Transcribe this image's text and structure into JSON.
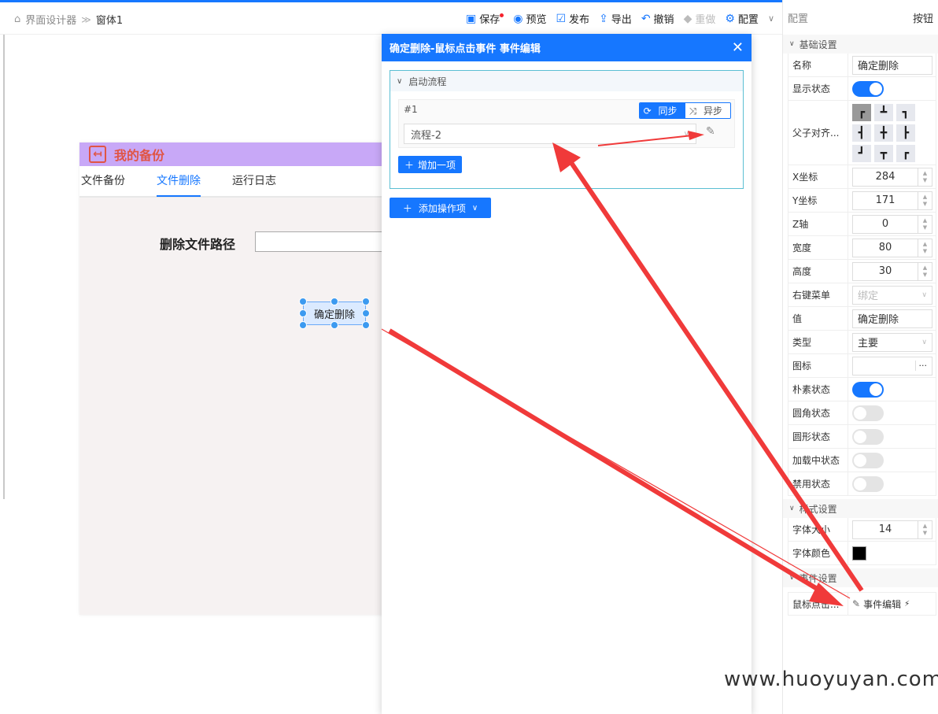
{
  "breadcrumb": {
    "root": "界面设计器",
    "current": "窗体1",
    "sep": "≫"
  },
  "toolbar": [
    {
      "label": "保存",
      "icon": "save-icon"
    },
    {
      "label": "预览",
      "icon": "eye-icon"
    },
    {
      "label": "发布",
      "icon": "publish-icon"
    },
    {
      "label": "导出",
      "icon": "export-icon"
    },
    {
      "label": "撤销",
      "icon": "undo-icon"
    },
    {
      "label": "重做",
      "icon": "redo-icon"
    },
    {
      "label": "配置",
      "icon": "gear-icon"
    }
  ],
  "form": {
    "title": "我的备份",
    "tabs": [
      "文件备份",
      "文件删除",
      "运行日志"
    ],
    "path_label": "删除文件路径",
    "selected_button": "确定删除"
  },
  "dialog": {
    "title": "确定删除-鼠标点击事件 事件编辑",
    "section": "启动流程",
    "item_no": "#1",
    "sync": "同步",
    "async": "异步",
    "flow": "流程-2",
    "add_item": "增加一项",
    "add_op": "添加操作项"
  },
  "panel": {
    "title": "配置",
    "type": "按钮",
    "groups": {
      "basic": "基础设置",
      "style": "样式设置",
      "event": "事件设置"
    },
    "name": {
      "label": "名称",
      "value": "确定删除"
    },
    "show": {
      "label": "显示状态",
      "on": true
    },
    "align": {
      "label": "父子对齐..."
    },
    "x": {
      "label": "X坐标",
      "value": "284"
    },
    "y": {
      "label": "Y坐标",
      "value": "171"
    },
    "z": {
      "label": "Z轴",
      "value": "0"
    },
    "width": {
      "label": "宽度",
      "value": "80"
    },
    "height": {
      "label": "高度",
      "value": "30"
    },
    "context_menu": {
      "label": "右键菜单",
      "value": "绑定"
    },
    "val": {
      "label": "值",
      "value": "确定删除"
    },
    "btn_type": {
      "label": "类型",
      "value": "主要"
    },
    "icon": {
      "label": "图标",
      "value": "···"
    },
    "plain": {
      "label": "朴素状态",
      "on": true
    },
    "round": {
      "label": "圆角状态",
      "on": false
    },
    "circle": {
      "label": "圆形状态",
      "on": false
    },
    "loading": {
      "label": "加载中状态",
      "on": false
    },
    "disabled": {
      "label": "禁用状态",
      "on": false
    },
    "font_size": {
      "label": "字体大小",
      "value": "14"
    },
    "font_color": {
      "label": "字体颜色",
      "value": "#000000"
    },
    "click": {
      "label": "鼠标点击...",
      "value": "事件编辑"
    }
  },
  "watermark": "www.huoyuyan.com",
  "colors": {
    "accent": "#1677ff",
    "arrow": "#f03a3a",
    "form_title_bg": "#c8a8f7",
    "form_title_text": "#e05545"
  }
}
